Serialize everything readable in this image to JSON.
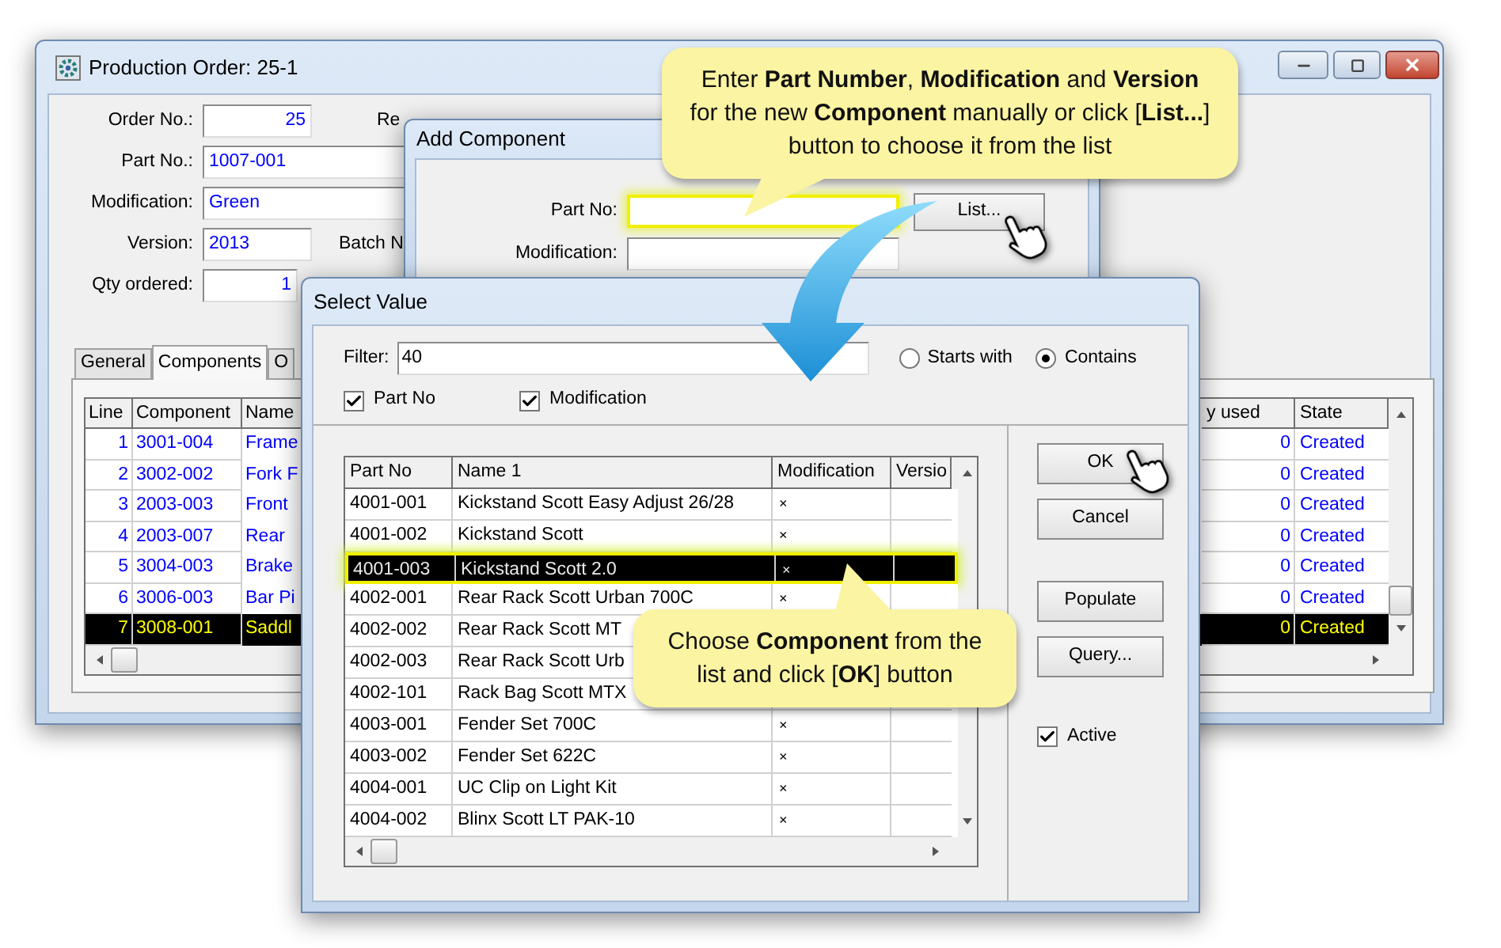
{
  "main_window": {
    "title": "Production Order: 25-1",
    "fields": [
      {
        "label": "Order No.:",
        "value": "25",
        "kind": "number",
        "side_label": "Re"
      },
      {
        "label": "Part No.:",
        "value": "1007-001",
        "kind": "text"
      },
      {
        "label": "Modification:",
        "value": "Green",
        "kind": "text"
      },
      {
        "label": "Version:",
        "value": "2013",
        "kind": "text",
        "side_label": "Batch N"
      },
      {
        "label": "Qty ordered:",
        "value": "1",
        "kind": "number"
      }
    ],
    "tabs": [
      {
        "label": "General",
        "selected": false
      },
      {
        "label": "Components",
        "selected": true
      },
      {
        "label": "O",
        "selected": false
      }
    ],
    "grid": {
      "columns_left": [
        "Line",
        "Component",
        "Name"
      ],
      "columns_right": [
        "y used",
        "State"
      ],
      "rows": [
        {
          "line": "1",
          "component": "3001-004",
          "name": "Frame",
          "qty": "0",
          "state": "Created",
          "selected": false
        },
        {
          "line": "2",
          "component": "3002-002",
          "name": "Fork F",
          "qty": "0",
          "state": "Created",
          "selected": false
        },
        {
          "line": "3",
          "component": "2003-003",
          "name": "Front",
          "qty": "0",
          "state": "Created",
          "selected": false
        },
        {
          "line": "4",
          "component": "2003-007",
          "name": "Rear",
          "qty": "0",
          "state": "Created",
          "selected": false
        },
        {
          "line": "5",
          "component": "3004-003",
          "name": "Brake",
          "qty": "0",
          "state": "Created",
          "selected": false
        },
        {
          "line": "6",
          "component": "3006-003",
          "name": "Bar Pi",
          "qty": "0",
          "state": "Created",
          "selected": false
        },
        {
          "line": "7",
          "component": "3008-001",
          "name": "Saddl",
          "qty": "0",
          "state": "Created",
          "selected": true
        }
      ]
    }
  },
  "add_component": {
    "title": "Add Component",
    "fields": [
      {
        "label": "Part No:",
        "highlighted": true
      },
      {
        "label": "Modification:",
        "highlighted": false
      }
    ],
    "list_button": "List..."
  },
  "select_value": {
    "title": "Select Value",
    "filter": {
      "label": "Filter:",
      "value": "40"
    },
    "match_options": [
      {
        "label": "Starts with",
        "selected": false
      },
      {
        "label": "Contains",
        "selected": true
      }
    ],
    "search_in": [
      {
        "label": "Part No",
        "checked": true
      },
      {
        "label": "Modification",
        "checked": true
      }
    ],
    "table": {
      "columns": [
        "Part No",
        "Name 1",
        "Modification",
        "Versio"
      ],
      "rows": [
        {
          "part_no": "4001-001",
          "name": "Kickstand Scott Easy Adjust 26/28",
          "modification": "×",
          "selected": false
        },
        {
          "part_no": "4001-002",
          "name": "Kickstand Scott",
          "modification": "×",
          "selected": false
        },
        {
          "part_no": "4001-003",
          "name": "Kickstand Scott 2.0",
          "modification": "×",
          "selected": true
        },
        {
          "part_no": "4002-001",
          "name": "Rear Rack Scott Urban 700C",
          "modification": "×",
          "selected": false
        },
        {
          "part_no": "4002-002",
          "name": "Rear Rack Scott MT",
          "selected": false
        },
        {
          "part_no": "4002-003",
          "name": "Rear Rack Scott Urb",
          "selected": false
        },
        {
          "part_no": "4002-101",
          "name": "Rack Bag Scott MTX",
          "selected": false
        },
        {
          "part_no": "4003-001",
          "name": "Fender Set 700C",
          "modification": "×",
          "selected": false
        },
        {
          "part_no": "4003-002",
          "name": "Fender Set 622C",
          "modification": "×",
          "selected": false
        },
        {
          "part_no": "4004-001",
          "name": "UC Clip on Light Kit",
          "modification": "×",
          "selected": false
        },
        {
          "part_no": "4004-002",
          "name": "Blinx Scott LT PAK-10",
          "modification": "×",
          "selected": false
        }
      ]
    },
    "buttons": [
      "OK",
      "Cancel",
      "Populate",
      "Query..."
    ],
    "active": {
      "label": "Active",
      "checked": true
    }
  },
  "callouts": [
    {
      "text": "Enter **Part Number**, **Modification** and **Version** for the new **Component** manually or click [**List...**] button to choose it from the list"
    },
    {
      "text": "Choose **Component** from the list and click [**OK**] button"
    }
  ]
}
